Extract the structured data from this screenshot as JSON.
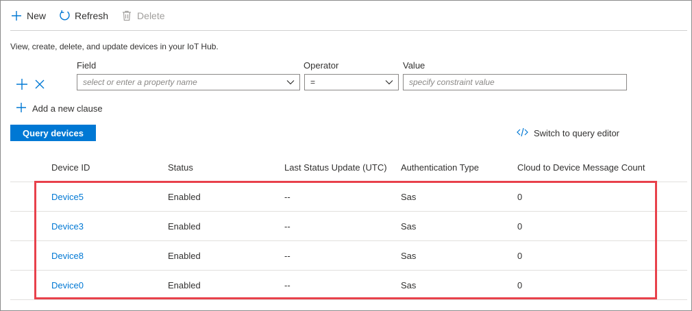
{
  "toolbar": {
    "new_label": "New",
    "refresh_label": "Refresh",
    "delete_label": "Delete"
  },
  "description": "View, create, delete, and update devices in your IoT Hub.",
  "filter": {
    "field_label": "Field",
    "operator_label": "Operator",
    "value_label": "Value",
    "field_placeholder": "select or enter a property name",
    "operator_value": "=",
    "value_placeholder": "specify constraint value",
    "add_clause_label": "Add a new clause"
  },
  "query_button_label": "Query devices",
  "switch_editor_label": "Switch to query editor",
  "table": {
    "columns": [
      "Device ID",
      "Status",
      "Last Status Update (UTC)",
      "Authentication Type",
      "Cloud to Device Message Count"
    ],
    "rows": [
      [
        "Device5",
        "Enabled",
        "--",
        "Sas",
        "0"
      ],
      [
        "Device3",
        "Enabled",
        "--",
        "Sas",
        "0"
      ],
      [
        "Device8",
        "Enabled",
        "--",
        "Sas",
        "0"
      ],
      [
        "Device0",
        "Enabled",
        "--",
        "Sas",
        "0"
      ]
    ]
  },
  "colors": {
    "accent": "#0078d4",
    "highlight": "#e8414b"
  }
}
